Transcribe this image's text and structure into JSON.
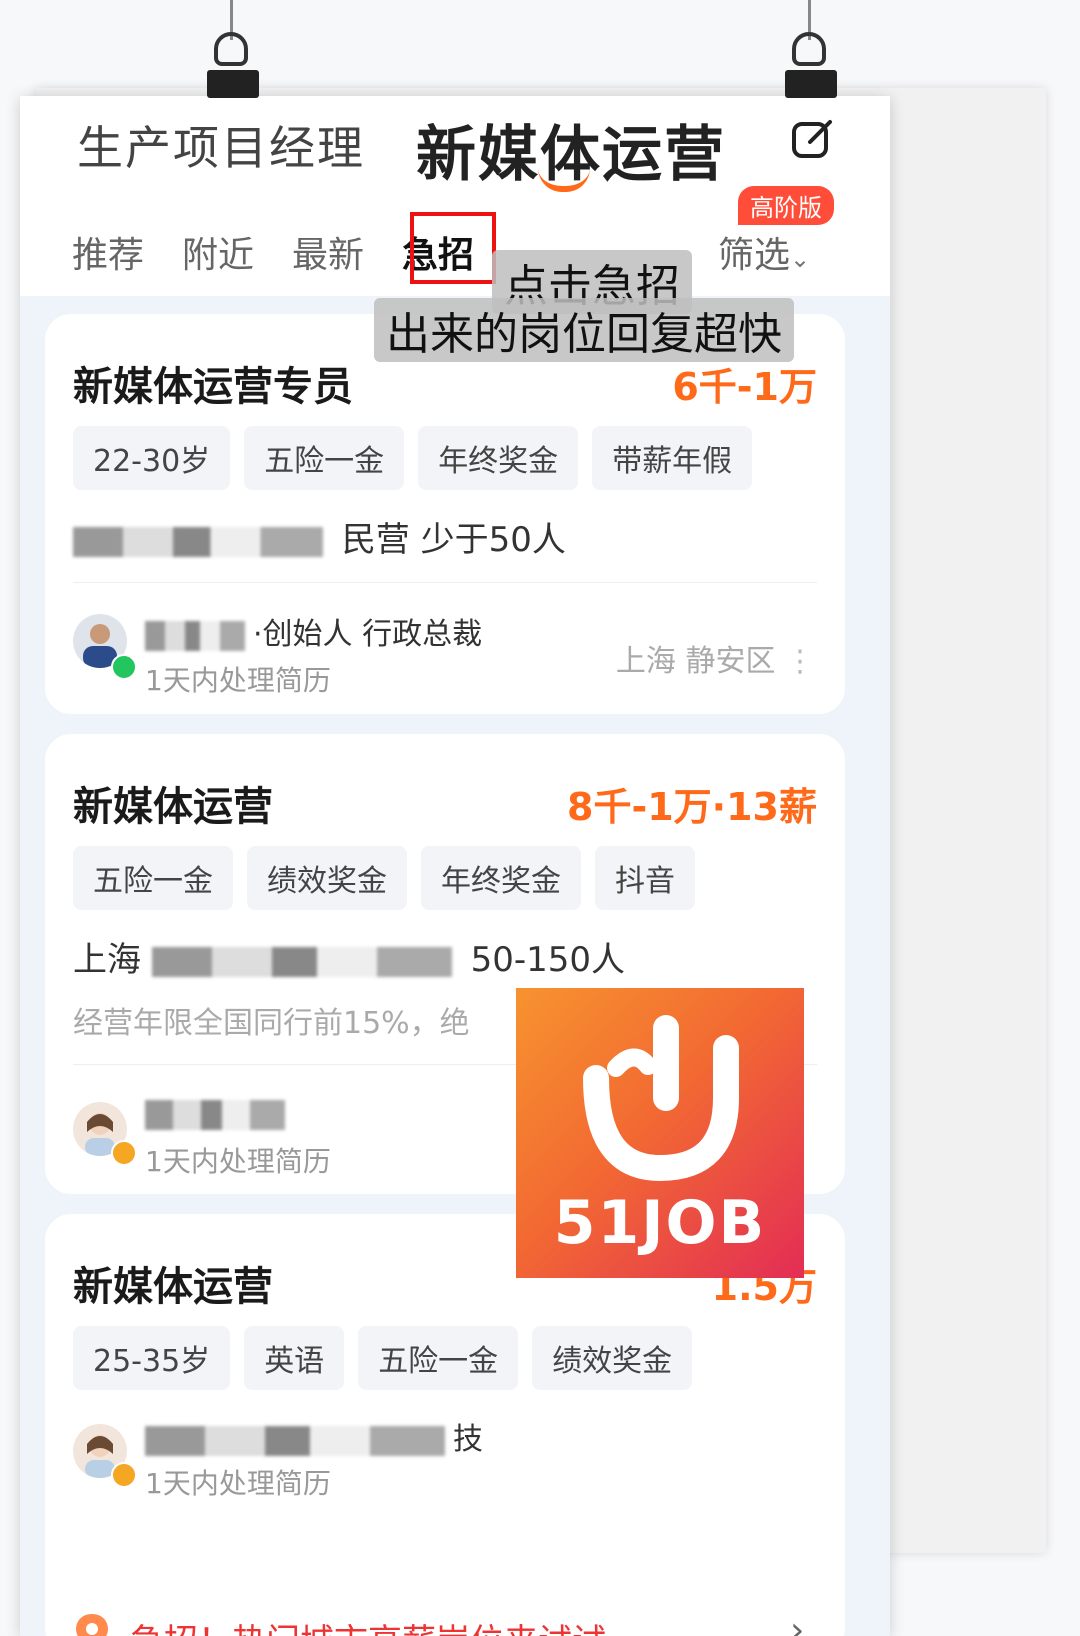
{
  "header": {
    "keyword_1": "生产项目经理",
    "keyword_2": "新媒体运营"
  },
  "tabs": [
    {
      "label": "推荐"
    },
    {
      "label": "附近"
    },
    {
      "label": "最新"
    },
    {
      "label": "急招"
    }
  ],
  "filter": {
    "label": "筛选",
    "badge": "高阶版"
  },
  "annotation": {
    "line1": "点击急招",
    "line2": "出来的岗位回复超快"
  },
  "jobs": [
    {
      "title": "新媒体运营专员",
      "salary": "6千-1万",
      "tags": [
        "22-30岁",
        "五险一金",
        "年终奖金",
        "带薪年假"
      ],
      "company_tail": "民营  少于50人",
      "recruiter": "·创始人 行政总裁",
      "reply": "1天内处理简历",
      "location": "上海  静安区",
      "more": "⋮"
    },
    {
      "title": "新媒体运营",
      "salary": "8千-1万·13薪",
      "tags": [
        "五险一金",
        "绩效奖金",
        "年终奖金",
        "抖音"
      ],
      "company_head": "上海",
      "company_tail": "50-150人",
      "desc": "经营年限全国同行前15%，绝",
      "reply": "1天内处理简历"
    },
    {
      "title": "新媒体运营",
      "salary": "1.5万",
      "tags": [
        "25-35岁",
        "英语",
        "五险一金",
        "绩效奖金"
      ],
      "recruiter_tail": "技",
      "reply": "1天内处理简历"
    }
  ],
  "footer": {
    "text": "急招！热门城市高薪岗位来试试"
  },
  "logo": {
    "text": "51JOB"
  },
  "colors": {
    "accent": "#ff6a1a",
    "urgent_box": "#ee1111",
    "online_dot": "#22c55e",
    "away_dot": "#f5a623"
  }
}
